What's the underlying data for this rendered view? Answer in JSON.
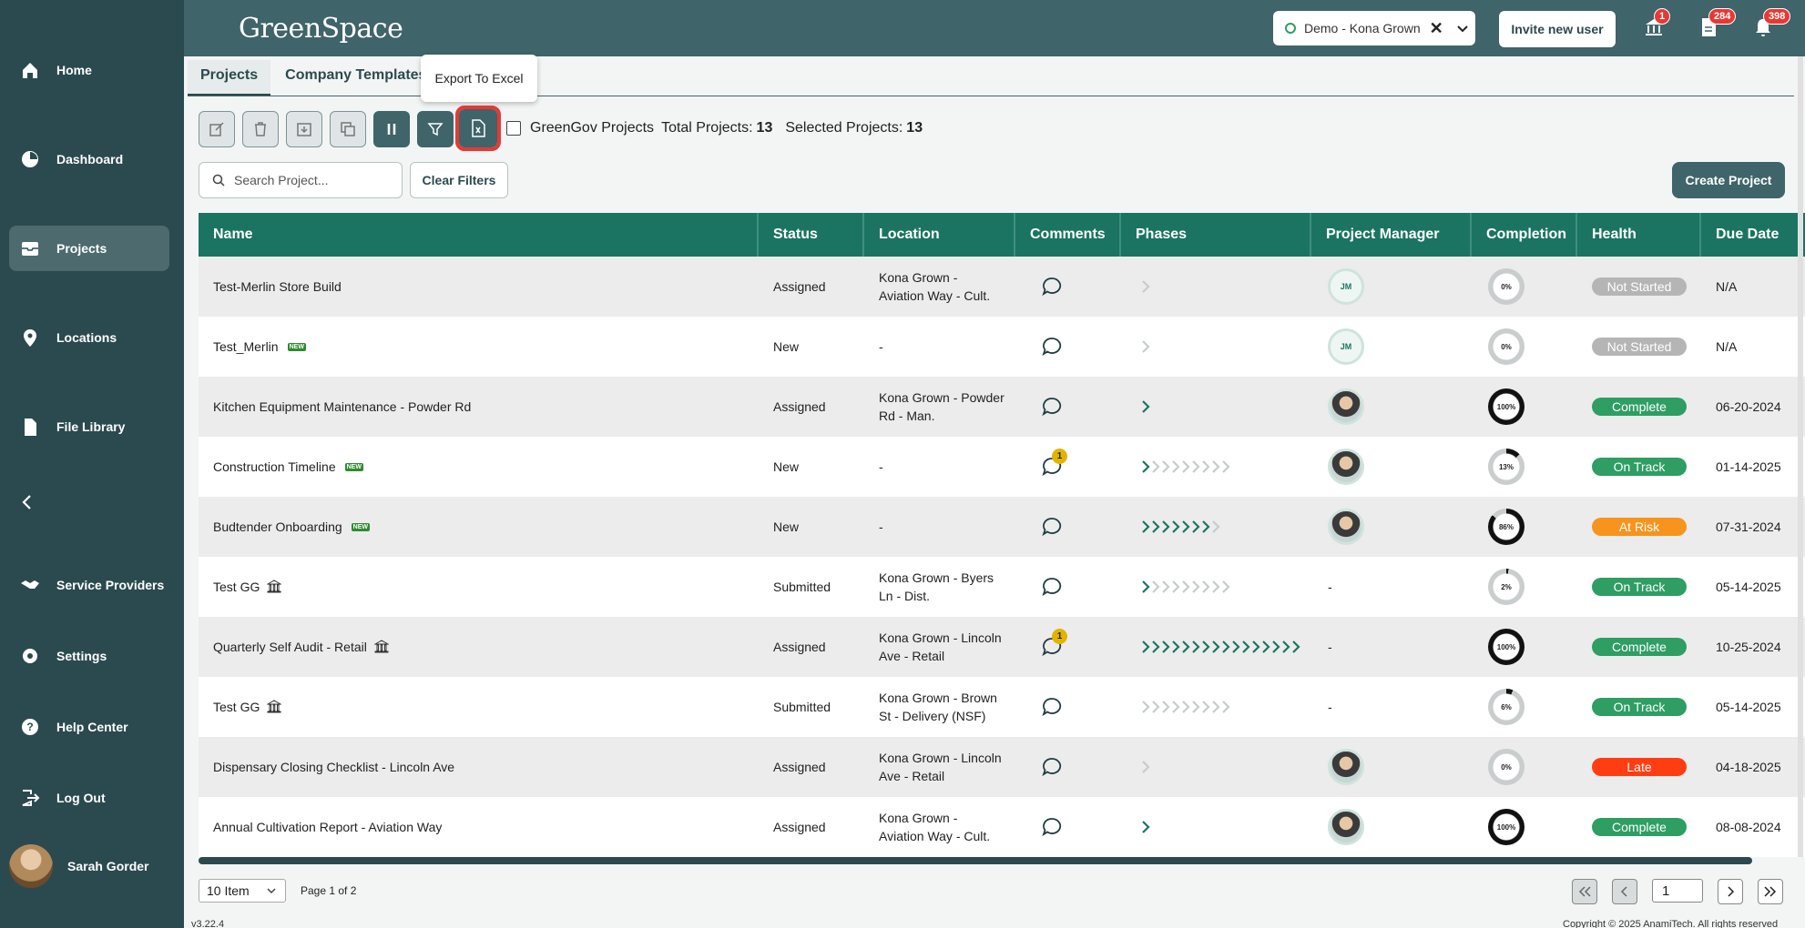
{
  "brand": {
    "logo": "GreenSpace"
  },
  "nav": {
    "items": [
      {
        "label": "Home",
        "icon": "home-icon"
      },
      {
        "label": "Dashboard",
        "icon": "dashboard-icon"
      },
      {
        "label": "Projects",
        "icon": "projects-icon"
      },
      {
        "label": "Locations",
        "icon": "location-pin-icon"
      },
      {
        "label": "File Library",
        "icon": "file-icon"
      },
      {
        "label": "Service Providers",
        "icon": "handshake-icon"
      },
      {
        "label": "Settings",
        "icon": "gear-icon"
      },
      {
        "label": "Help Center",
        "icon": "help-icon"
      },
      {
        "label": "Log Out",
        "icon": "logout-icon"
      }
    ],
    "active": "Projects"
  },
  "user": {
    "name": "Sarah Gorder"
  },
  "header": {
    "tenant": "Demo - Kona Grown",
    "invite_label": "Invite new user",
    "badges": {
      "bank": "1",
      "docs": "284",
      "bell": "398"
    }
  },
  "tabs": [
    "Projects",
    "Company Templates"
  ],
  "tooltip": "Export To Excel",
  "toolbar": {
    "greengov_label": "GreenGov Projects",
    "total_label": "Total Projects:",
    "total_value": "13",
    "selected_label": "Selected Projects:",
    "selected_value": "13"
  },
  "search": {
    "placeholder": "Search Project..."
  },
  "clear_filters": "Clear Filters",
  "create_project": "Create Project",
  "columns": [
    "Name",
    "Status",
    "Location",
    "Comments",
    "Phases",
    "Project Manager",
    "Completion",
    "Health",
    "Due Date"
  ],
  "rows": [
    {
      "name": "Test-Merlin Store Build",
      "status": "Assigned",
      "location": "Kona Grown - Aviation Way - Cult.",
      "comments": "",
      "phases_done": 0,
      "phases_total": 1,
      "pm": "JM",
      "completion": "0%",
      "completion_pct": 0,
      "health": "Not Started",
      "health_color": "#b5b5b5",
      "due": "N/A"
    },
    {
      "name": "Test_Merlin",
      "tag": "NEW",
      "status": "New",
      "location": "-",
      "comments": "",
      "phases_done": 0,
      "phases_total": 1,
      "pm": "JM",
      "completion": "0%",
      "completion_pct": 0,
      "health": "Not Started",
      "health_color": "#b5b5b5",
      "due": "N/A"
    },
    {
      "name": "Kitchen Equipment Maintenance - Powder Rd",
      "status": "Assigned",
      "location": "Kona Grown - Powder Rd - Man.",
      "comments": "",
      "phases_done": 1,
      "phases_total": 1,
      "pm": "photo",
      "completion": "100%",
      "completion_pct": 100,
      "health": "Complete",
      "health_color": "#2e9e63",
      "due": "06-20-2024"
    },
    {
      "name": "Construction Timeline",
      "tag": "NEW",
      "status": "New",
      "location": "-",
      "comments": "1",
      "phases_done": 1,
      "phases_total": 9,
      "pm": "photo",
      "completion": "13%",
      "completion_pct": 13,
      "health": "On Track",
      "health_color": "#2e9e63",
      "due": "01-14-2025"
    },
    {
      "name": "Budtender Onboarding",
      "tag": "NEW",
      "status": "New",
      "location": "-",
      "comments": "",
      "phases_done": 7,
      "phases_total": 8,
      "pm": "photo",
      "completion": "86%",
      "completion_pct": 86,
      "health": "At Risk",
      "health_color": "#f7941d",
      "due": "07-31-2024"
    },
    {
      "name": "Test GG",
      "bank": true,
      "status": "Submitted",
      "location": "Kona Grown - Byers Ln - Dist.",
      "comments": "",
      "phases_done": 1,
      "phases_total": 9,
      "pm": "-",
      "completion": "2%",
      "completion_pct": 2,
      "health": "On Track",
      "health_color": "#2e9e63",
      "due": "05-14-2025"
    },
    {
      "name": "Quarterly Self Audit - Retail",
      "bank": true,
      "status": "Assigned",
      "location": "Kona Grown - Lincoln Ave - Retail",
      "comments": "1",
      "phases_done": 16,
      "phases_total": 16,
      "pm": "-",
      "completion": "100%",
      "completion_pct": 100,
      "health": "Complete",
      "health_color": "#2e9e63",
      "due": "10-25-2024"
    },
    {
      "name": "Test GG",
      "bank": true,
      "status": "Submitted",
      "location": "Kona Grown - Brown St - Delivery (NSF)",
      "comments": "",
      "phases_done": 0,
      "phases_total": 9,
      "pm": "-",
      "completion": "6%",
      "completion_pct": 6,
      "health": "On Track",
      "health_color": "#2e9e63",
      "due": "05-14-2025"
    },
    {
      "name": "Dispensary Closing Checklist - Lincoln Ave",
      "status": "Assigned",
      "location": "Kona Grown - Lincoln Ave - Retail",
      "comments": "",
      "phases_done": 0,
      "phases_total": 1,
      "pm": "photo",
      "completion": "0%",
      "completion_pct": 0,
      "health": "Late",
      "health_color": "#ff3d12",
      "due": "04-18-2025"
    },
    {
      "name": "Annual Cultivation Report - Aviation Way",
      "status": "Assigned",
      "location": "Kona Grown - Aviation Way - Cult.",
      "comments": "",
      "phases_done": 1,
      "phases_total": 1,
      "pm": "photo",
      "completion": "100%",
      "completion_pct": 100,
      "health": "Complete",
      "health_color": "#2e9e63",
      "due": "08-08-2024"
    }
  ],
  "pagination": {
    "page_size": "10 Item",
    "page_text": "Page 1 of 2",
    "current": "1"
  },
  "footer": {
    "version": "v3.22.4",
    "copyright": "Copyright © 2025 AnamiTech. All rights reserved"
  }
}
